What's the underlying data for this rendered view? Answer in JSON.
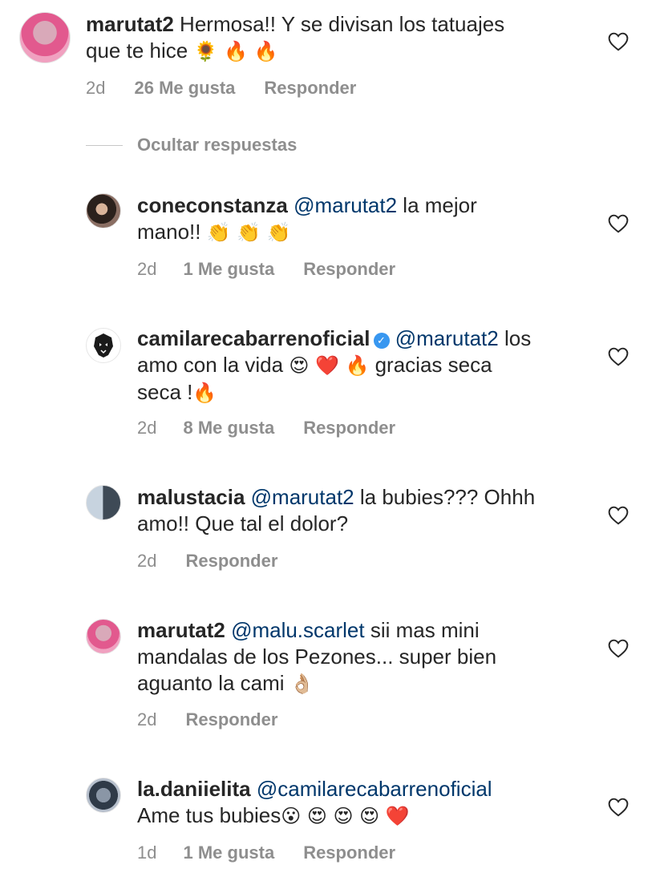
{
  "comments": [
    {
      "username": "marutat2",
      "text_before": " Hermosa!! Y se divisan los tatuajes\nque te hice ",
      "emojis": "🌻 🔥 🔥",
      "time": "2d",
      "likes": "26 Me gusta",
      "reply": "Responder"
    },
    {
      "username": "coneconstanza",
      "mention": "@marutat2",
      "text": " la mejor\nmano!! ",
      "emojis": "👏 👏 👏",
      "time": "2d",
      "likes": "1 Me gusta",
      "reply": "Responder"
    },
    {
      "username": "camilarecabarrenoficial",
      "verified": "✓",
      "mention": "@marutat2",
      "text": " los\namo con la vida ",
      "emojis": "😍 ❤️ 🔥",
      "text_after": " gracias seca\nseca !",
      "emoji_end": "🔥",
      "time": "2d",
      "likes": "8 Me gusta",
      "reply": "Responder"
    },
    {
      "username": "malustacia",
      "mention": "@marutat2",
      "text": " la bubies??? Ohhh\namo!! Que tal el dolor?",
      "time": "2d",
      "reply": "Responder"
    },
    {
      "username": "marutat2",
      "mention": "@malu.scarlet",
      "text": " sii mas mini\nmandalas de los Pezones... super bien\naguanto la cami ",
      "emojis": "👌🏼",
      "time": "2d",
      "reply": "Responder"
    },
    {
      "username": "la.daniielita",
      "mention": "@camilarecabarrenoficial",
      "text": "\nAme tus bubies",
      "emojis": "😮 😍 😍 😍 ❤️",
      "time": "1d",
      "likes": "1 Me gusta",
      "reply": "Responder"
    }
  ],
  "hide_replies": "Ocultar respuestas",
  "colors": {
    "text": "#262626",
    "meta": "#8e8e8e",
    "mention": "#00376b",
    "verified": "#3897f0"
  },
  "icons": {
    "like": "heart-outline-icon"
  }
}
